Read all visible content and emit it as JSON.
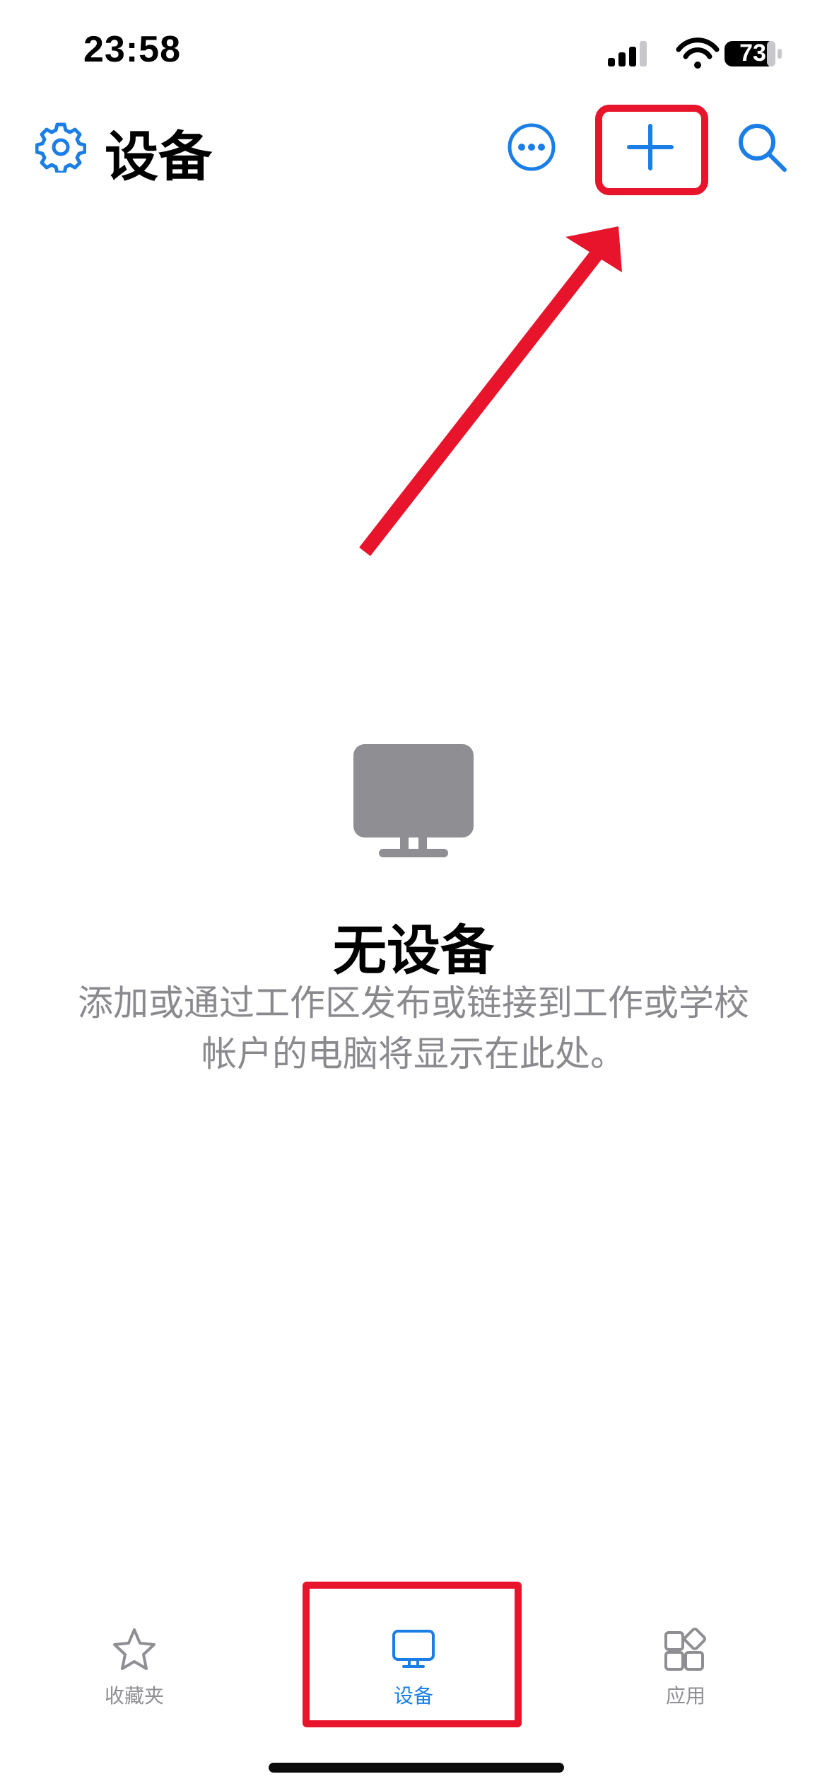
{
  "status_bar": {
    "time": "23:58",
    "battery": "73"
  },
  "nav": {
    "title": "设备",
    "settings_icon": "gear-icon",
    "more_icon": "ellipsis-circle-icon",
    "add_icon": "plus-icon",
    "search_icon": "search-icon"
  },
  "empty_state": {
    "icon": "monitor-icon",
    "title": "无设备",
    "description": "添加或通过工作区发布或链接到工作或学校帐户的电脑将显示在此处。"
  },
  "tabs": [
    {
      "label": "收藏夹",
      "icon": "star-icon",
      "active": false
    },
    {
      "label": "设备",
      "icon": "monitor-icon",
      "active": true
    },
    {
      "label": "应用",
      "icon": "apps-icon",
      "active": false
    }
  ],
  "colors": {
    "accent": "#1b7ee6",
    "annotation": "#e8142b",
    "secondary_text": "#8a8a8e",
    "placeholder_icon": "#8e8e93"
  }
}
